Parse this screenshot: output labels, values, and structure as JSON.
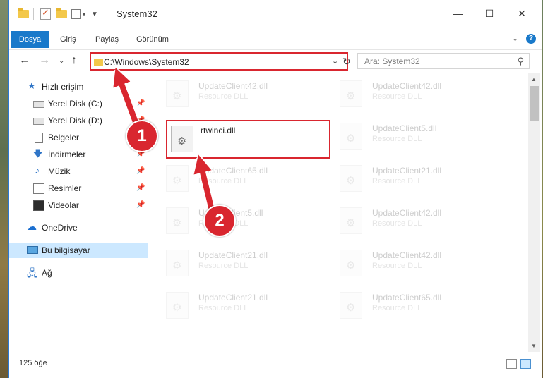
{
  "titlebar": {
    "title": "System32",
    "controls": {
      "minimize": "—",
      "maximize": "☐",
      "close": "✕"
    }
  },
  "ribbon": {
    "tabs": [
      "Dosya",
      "Giriş",
      "Paylaş",
      "Görünüm"
    ],
    "expand_glyph": "⌄",
    "help_glyph": "?"
  },
  "address_bar": {
    "path": "C:\\Windows\\System32",
    "chevron_glyph": "⌄",
    "refresh_glyph": "↻",
    "nav": {
      "back": "←",
      "forward": "→",
      "recent": "⌄",
      "up": "↑"
    }
  },
  "search": {
    "placeholder": "Ara: System32",
    "icon": "search-icon",
    "glyph": "⚲"
  },
  "nav_pane": {
    "pin_glyph": "📌",
    "items": [
      {
        "label": "Hızlı erişim",
        "icon": "star-icon",
        "glyph": "★",
        "pinned": false
      },
      {
        "label": "Yerel Disk (C:)",
        "icon": "drive-icon",
        "pinned": true
      },
      {
        "label": "Yerel Disk (D:)",
        "icon": "drive-icon",
        "pinned": true
      },
      {
        "label": "Belgeler",
        "icon": "documents-icon",
        "pinned": true
      },
      {
        "label": "İndirmeler",
        "icon": "downloads-icon",
        "glyph": "🡇",
        "pinned": true
      },
      {
        "label": "Müzik",
        "icon": "music-icon",
        "glyph": "♪",
        "pinned": true
      },
      {
        "label": "Resimler",
        "icon": "pictures-icon",
        "pinned": true
      },
      {
        "label": "Videolar",
        "icon": "videos-icon",
        "pinned": true
      },
      {
        "label": "OneDrive",
        "icon": "onedrive-icon",
        "glyph": "☁"
      },
      {
        "label": "Bu bilgisayar",
        "icon": "this-pc-icon",
        "selected": true
      },
      {
        "label": "Ağ",
        "icon": "network-icon",
        "glyph": "🖧"
      }
    ]
  },
  "files": {
    "highlighted": {
      "name": "rtwinci.dll"
    },
    "tiles": [
      {
        "name": "UpdateClient42.dll",
        "type": "Resource DLL"
      },
      {
        "name": "UpdateClient42.dll",
        "type": "Resource DLL"
      },
      {
        "name": "UpdateClient5.dll",
        "type": "Resource DLL"
      },
      {
        "name": "UpdateClient65.dll",
        "type": "Resource DLL"
      },
      {
        "name": "UpdateClient21.dll",
        "type": "Resource DLL"
      },
      {
        "name": "UpdateClient5.dll",
        "type": "Resource DLL"
      },
      {
        "name": "UpdateClient42.dll",
        "type": "Resource DLL"
      },
      {
        "name": "UpdateClient21.dll",
        "type": "Resource DLL"
      },
      {
        "name": "UpdateClient42.dll",
        "type": "Resource DLL"
      },
      {
        "name": "UpdateClient21.dll",
        "type": "Resource DLL"
      },
      {
        "name": "UpdateClient65.dll",
        "type": "Resource DLL"
      }
    ]
  },
  "status_bar": {
    "item_count": "125 öğe"
  },
  "annotations": {
    "step1": "1",
    "step2": "2"
  },
  "colors": {
    "accent": "#1979ca",
    "highlight": "#d9262f",
    "selection": "#cce8ff"
  }
}
